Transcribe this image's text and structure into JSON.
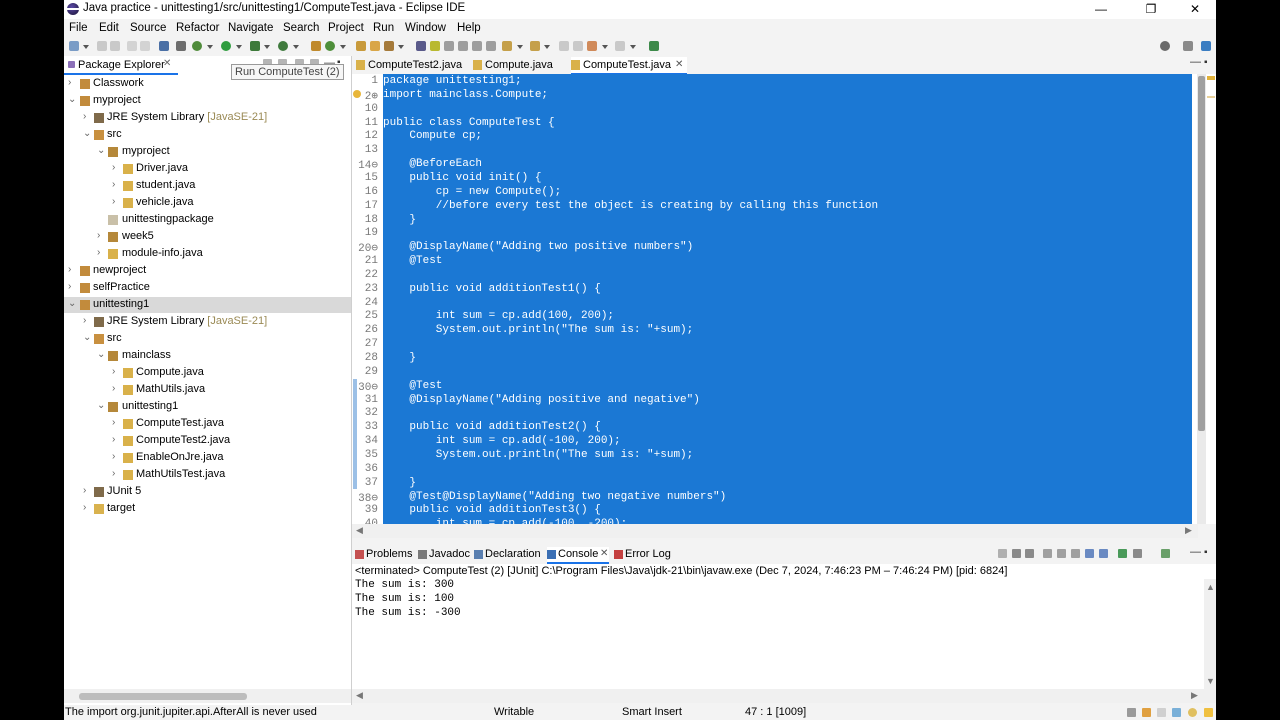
{
  "window": {
    "title": "Java practice - unittesting1/src/unittesting1/ComputeTest.java - Eclipse IDE",
    "minimize": "—",
    "maximize": "❐",
    "close": "✕"
  },
  "menu": [
    "File",
    "Edit",
    "Source",
    "Refactor",
    "Navigate",
    "Search",
    "Project",
    "Run",
    "Window",
    "Help"
  ],
  "tooltip": "Run ComputeTest (2)",
  "package_explorer": {
    "tab_label": "Package Explorer",
    "tree": [
      {
        "label": "Classwork",
        "extra": ""
      },
      {
        "label": "myproject",
        "extra": ""
      },
      {
        "label": "JRE System Library",
        "extra": "[JavaSE-21]"
      },
      {
        "label": "src",
        "extra": ""
      },
      {
        "label": "myproject",
        "extra": ""
      },
      {
        "label": "Driver.java",
        "extra": ""
      },
      {
        "label": "student.java",
        "extra": ""
      },
      {
        "label": "vehicle.java",
        "extra": ""
      },
      {
        "label": "unittestingpackage",
        "extra": ""
      },
      {
        "label": "week5",
        "extra": ""
      },
      {
        "label": "module-info.java",
        "extra": ""
      },
      {
        "label": "newproject",
        "extra": ""
      },
      {
        "label": "selfPractice",
        "extra": ""
      },
      {
        "label": "unittesting1",
        "extra": ""
      },
      {
        "label": "JRE System Library",
        "extra": "[JavaSE-21]"
      },
      {
        "label": "src",
        "extra": ""
      },
      {
        "label": "mainclass",
        "extra": ""
      },
      {
        "label": "Compute.java",
        "extra": ""
      },
      {
        "label": "MathUtils.java",
        "extra": ""
      },
      {
        "label": "unittesting1",
        "extra": ""
      },
      {
        "label": "ComputeTest.java",
        "extra": ""
      },
      {
        "label": "ComputeTest2.java",
        "extra": ""
      },
      {
        "label": "EnableOnJre.java",
        "extra": ""
      },
      {
        "label": "MathUtilsTest.java",
        "extra": ""
      },
      {
        "label": "JUnit 5",
        "extra": ""
      },
      {
        "label": "target",
        "extra": ""
      }
    ]
  },
  "editor": {
    "tabs": [
      {
        "label": "ComputeTest2.java"
      },
      {
        "label": "Compute.java"
      },
      {
        "label": "ComputeTest.java",
        "close": "✕"
      }
    ],
    "lines": [
      {
        "n": "1",
        "code": "package unittesting1;"
      },
      {
        "n": "2⊕",
        "code": "import mainclass.Compute;"
      },
      {
        "n": "10",
        "code": ""
      },
      {
        "n": "11",
        "code": "public class ComputeTest {"
      },
      {
        "n": "12",
        "code": "    Compute cp;"
      },
      {
        "n": "13",
        "code": ""
      },
      {
        "n": "14⊖",
        "code": "    @BeforeEach"
      },
      {
        "n": "15",
        "code": "    public void init() {"
      },
      {
        "n": "16",
        "code": "        cp = new Compute();"
      },
      {
        "n": "17",
        "code": "        //before every test the object is creating by calling this function"
      },
      {
        "n": "18",
        "code": "    }"
      },
      {
        "n": "19",
        "code": ""
      },
      {
        "n": "20⊖",
        "code": "    @DisplayName(\"Adding two positive numbers\")"
      },
      {
        "n": "21",
        "code": "    @Test"
      },
      {
        "n": "22",
        "code": ""
      },
      {
        "n": "23",
        "code": "    public void additionTest1() {"
      },
      {
        "n": "24",
        "code": ""
      },
      {
        "n": "25",
        "code": "        int sum = cp.add(100, 200);"
      },
      {
        "n": "26",
        "code": "        System.out.println(\"The sum is: \"+sum);"
      },
      {
        "n": "27",
        "code": ""
      },
      {
        "n": "28",
        "code": "    }"
      },
      {
        "n": "29",
        "code": ""
      },
      {
        "n": "30⊖",
        "code": "    @Test"
      },
      {
        "n": "31",
        "code": "    @DisplayName(\"Adding positive and negative\")"
      },
      {
        "n": "32",
        "code": ""
      },
      {
        "n": "33",
        "code": "    public void additionTest2() {"
      },
      {
        "n": "34",
        "code": "        int sum = cp.add(-100, 200);"
      },
      {
        "n": "35",
        "code": "        System.out.println(\"The sum is: \"+sum);"
      },
      {
        "n": "36",
        "code": ""
      },
      {
        "n": "37",
        "code": "    }"
      },
      {
        "n": "38⊖",
        "code": "    @Test@DisplayName(\"Adding two negative numbers\")"
      },
      {
        "n": "39",
        "code": "    public void additionTest3() {"
      },
      {
        "n": "40",
        "code": "        int sum = cp.add(-100, -200);"
      }
    ]
  },
  "bottom_panel": {
    "tabs": [
      {
        "label": "Problems"
      },
      {
        "label": "Javadoc"
      },
      {
        "label": "Declaration"
      },
      {
        "label": "Console",
        "close": "✕"
      },
      {
        "label": "Error Log"
      }
    ],
    "console_header": "<terminated> ComputeTest (2) [JUnit] C:\\Program Files\\Java\\jdk-21\\bin\\javaw.exe  (Dec 7, 2024, 7:46:23 PM – 7:46:24 PM) [pid: 6824]",
    "output": [
      "The sum is: 300",
      "The sum is: 100",
      "The sum is: -300"
    ]
  },
  "status_bar": {
    "message": "The import org.junit.jupiter.api.AfterAll is never used",
    "writable": "Writable",
    "insert_mode": "Smart Insert",
    "position": "47 : 1 [1009]"
  },
  "colors": {
    "selection": "#1b78d4",
    "accent": "#1a73e8",
    "library_suffix": "#9a8a55"
  }
}
